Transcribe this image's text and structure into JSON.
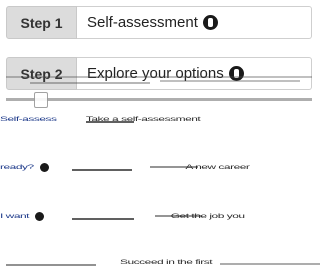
{
  "steps": [
    {
      "badge": "Step 1",
      "title": "Self-assessment",
      "icon": "info-circle-icon"
    },
    {
      "badge": "Step 2",
      "title": "Explore your options",
      "icon": "info-circle-icon"
    }
  ],
  "glitch_rows": [
    {
      "left": "Self-assess",
      "right": "Take a self-assessment"
    },
    {
      "left": "ready?",
      "right": "A new career"
    },
    {
      "left": "I want",
      "right": "Get the job you"
    },
    {
      "left": "",
      "right": "Succeed in the first"
    }
  ],
  "colors": {
    "step_badge_bg": "#dcdcdc",
    "border": "#cfcfcf",
    "glitch_text": "#1e3a8a",
    "icon": "#1a1a1a"
  }
}
